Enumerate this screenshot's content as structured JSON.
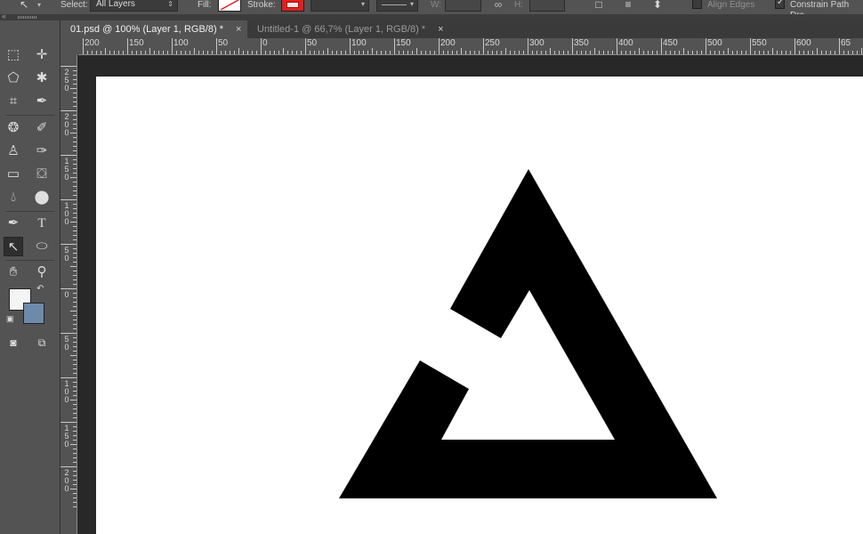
{
  "options_bar": {
    "select_label": "Select:",
    "select_value": "All Layers",
    "fill_label": "Fill:",
    "stroke_label": "Stroke:",
    "stroke_color": "#e02020",
    "width_label": "W:",
    "height_label": "H:",
    "align_edges_label": "Align Edges",
    "align_edges_checked": false,
    "constrain_label": "Constrain Path Dra",
    "constrain_checked": true
  },
  "tabs": [
    {
      "label": "01.psd @ 100% (Layer 1, RGB/8) *",
      "active": true,
      "close": "×"
    },
    {
      "label": "Untitled-1 @ 66,7% (Layer 1, RGB/8) *",
      "active": false,
      "close": "×"
    }
  ],
  "ruler": {
    "horizontal": [
      "200",
      "150",
      "100",
      "50",
      "0",
      "50",
      "100",
      "150",
      "200",
      "250",
      "300",
      "350",
      "400",
      "450",
      "500",
      "550",
      "600",
      "65"
    ],
    "vertical": [
      "250",
      "200",
      "150",
      "100",
      "50",
      "0",
      "50",
      "100",
      "150",
      "200"
    ]
  },
  "tools": {
    "foreground_color": "#f4f4f4",
    "background_color": "#6e8aab"
  },
  "colors": {
    "canvas": "#ffffff",
    "shape": "#000000",
    "panel": "#535353",
    "workspace": "#282828"
  }
}
